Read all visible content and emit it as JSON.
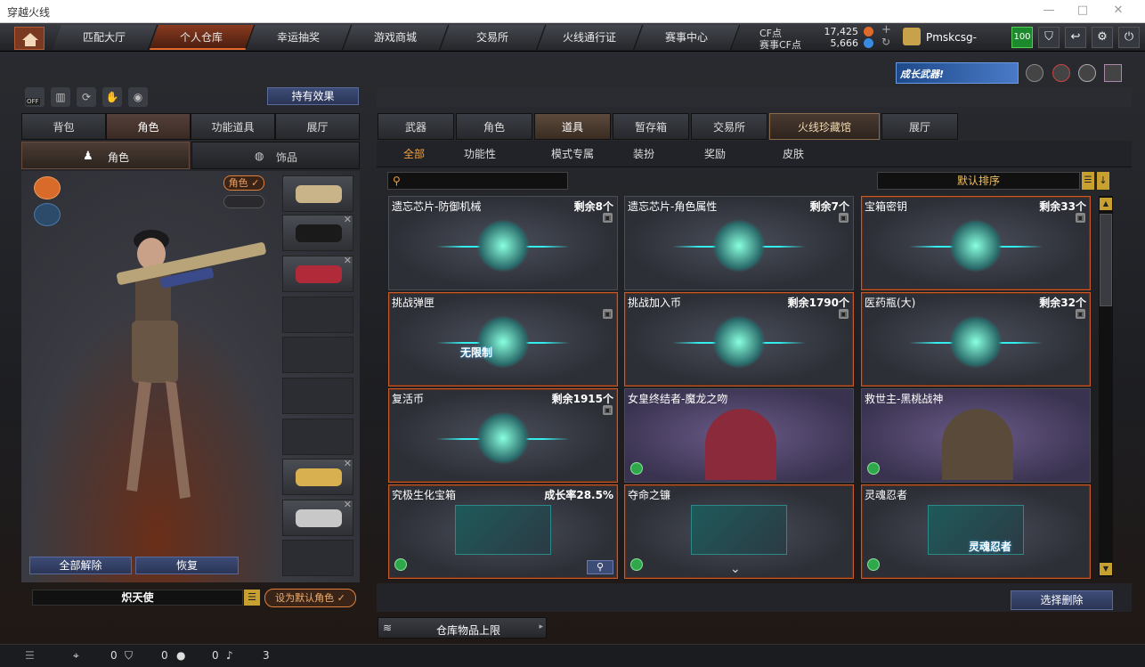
{
  "window": {
    "title": "穿越火线",
    "min": "—",
    "max": "□",
    "close": "✕"
  },
  "nav": {
    "tabs": [
      "匹配大厅",
      "个人仓库",
      "幸运抽奖",
      "游戏商城",
      "交易所",
      "火线通行证",
      "赛事中心"
    ],
    "active": 1,
    "cf_label": "CF点",
    "cf_value": "17,425",
    "cf_plus": "+",
    "scf_label": "赛事CF点",
    "scf_value": "5,666",
    "scf_refresh": "↻",
    "username": "Pmskcsg-",
    "level": "100",
    "icons": [
      "shield-icon",
      "back-icon",
      "gear-icon",
      "power-icon"
    ]
  },
  "promo": {
    "text": "成长武器!"
  },
  "left": {
    "effect_button": "持有效果",
    "off_label": "OFF",
    "tabs": [
      "背包",
      "角色",
      "功能道具",
      "展厅"
    ],
    "active_tab": 1,
    "subtabs": [
      "角色",
      "饰品"
    ],
    "toggle_label": "角色",
    "unequip_all": "全部解除",
    "restore": "恢复",
    "char_name": "炽天使",
    "set_default": "设为默认角色"
  },
  "right": {
    "tabs": [
      "武器",
      "角色",
      "道具",
      "暂存箱",
      "交易所",
      "火线珍藏馆",
      "展厅"
    ],
    "active_tab": 2,
    "subtabs": [
      "全部",
      "功能性",
      "模式专属",
      "装扮",
      "奖励",
      "皮肤"
    ],
    "active_sub": 0,
    "sort_label": "默认排序",
    "select_delete": "选择删除",
    "capacity": "仓库物品上限",
    "items": [
      {
        "name": "遗忘芯片-防御机械",
        "count": "剩余8个",
        "style": "teal"
      },
      {
        "name": "遗忘芯片-角色属性",
        "count": "剩余7个",
        "style": "teal"
      },
      {
        "name": "宝箱密钥",
        "count": "剩余33个",
        "style": "orange"
      },
      {
        "name": "挑战弹匣",
        "count": "",
        "style": "orange",
        "overlay": "无限制"
      },
      {
        "name": "挑战加入币",
        "count": "剩余1790个",
        "style": "orange"
      },
      {
        "name": "医药瓶(大)",
        "count": "剩余32个",
        "style": "orange"
      },
      {
        "name": "复活币",
        "count": "剩余1915个",
        "style": "orange"
      },
      {
        "name": "女皇终结者-魔龙之吻",
        "count": "",
        "style": "purple"
      },
      {
        "name": "救世主-黑桃战神",
        "count": "",
        "style": "purple"
      },
      {
        "name": "究极生化宝箱",
        "count": "成长率28.5%",
        "style": "orange"
      },
      {
        "name": "夺命之镰",
        "count": "",
        "style": "orange"
      },
      {
        "name": "灵魂忍者",
        "count": "",
        "style": "orange",
        "overlay": "灵魂忍者"
      }
    ]
  },
  "footer": {
    "v1": "0",
    "v2": "0",
    "v3": "0",
    "v4": "3"
  }
}
